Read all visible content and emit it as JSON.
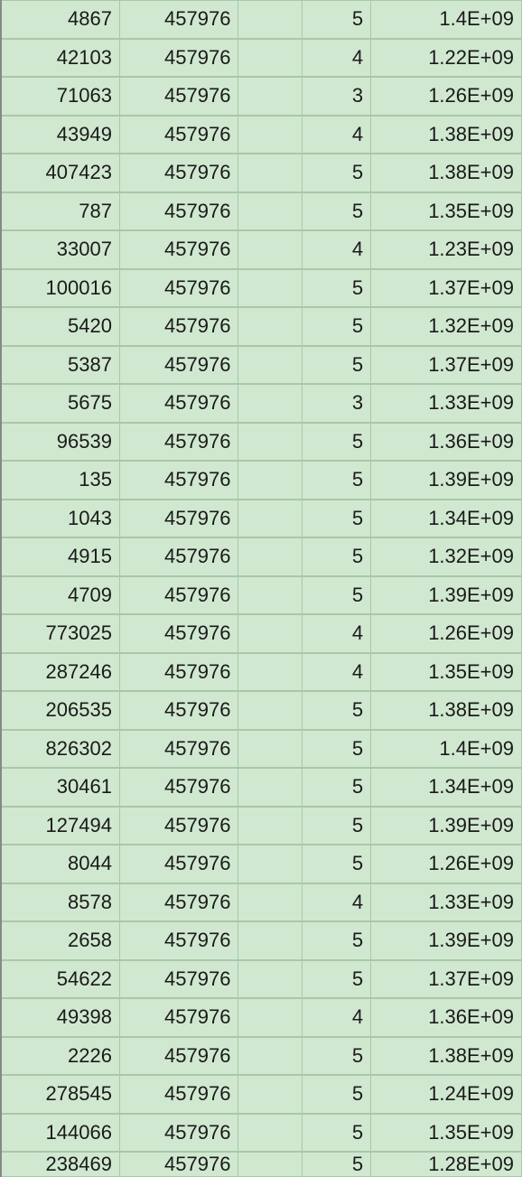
{
  "table": {
    "rows": [
      {
        "a": "4867",
        "b": "457976",
        "c": "",
        "d": "5",
        "e": "1.4E+09"
      },
      {
        "a": "42103",
        "b": "457976",
        "c": "",
        "d": "4",
        "e": "1.22E+09"
      },
      {
        "a": "71063",
        "b": "457976",
        "c": "",
        "d": "3",
        "e": "1.26E+09"
      },
      {
        "a": "43949",
        "b": "457976",
        "c": "",
        "d": "4",
        "e": "1.38E+09"
      },
      {
        "a": "407423",
        "b": "457976",
        "c": "",
        "d": "5",
        "e": "1.38E+09"
      },
      {
        "a": "787",
        "b": "457976",
        "c": "",
        "d": "5",
        "e": "1.35E+09"
      },
      {
        "a": "33007",
        "b": "457976",
        "c": "",
        "d": "4",
        "e": "1.23E+09"
      },
      {
        "a": "100016",
        "b": "457976",
        "c": "",
        "d": "5",
        "e": "1.37E+09"
      },
      {
        "a": "5420",
        "b": "457976",
        "c": "",
        "d": "5",
        "e": "1.32E+09"
      },
      {
        "a": "5387",
        "b": "457976",
        "c": "",
        "d": "5",
        "e": "1.37E+09"
      },
      {
        "a": "5675",
        "b": "457976",
        "c": "",
        "d": "3",
        "e": "1.33E+09"
      },
      {
        "a": "96539",
        "b": "457976",
        "c": "",
        "d": "5",
        "e": "1.36E+09"
      },
      {
        "a": "135",
        "b": "457976",
        "c": "",
        "d": "5",
        "e": "1.39E+09"
      },
      {
        "a": "1043",
        "b": "457976",
        "c": "",
        "d": "5",
        "e": "1.34E+09"
      },
      {
        "a": "4915",
        "b": "457976",
        "c": "",
        "d": "5",
        "e": "1.32E+09"
      },
      {
        "a": "4709",
        "b": "457976",
        "c": "",
        "d": "5",
        "e": "1.39E+09"
      },
      {
        "a": "773025",
        "b": "457976",
        "c": "",
        "d": "4",
        "e": "1.26E+09"
      },
      {
        "a": "287246",
        "b": "457976",
        "c": "",
        "d": "4",
        "e": "1.35E+09"
      },
      {
        "a": "206535",
        "b": "457976",
        "c": "",
        "d": "5",
        "e": "1.38E+09"
      },
      {
        "a": "826302",
        "b": "457976",
        "c": "",
        "d": "5",
        "e": "1.4E+09"
      },
      {
        "a": "30461",
        "b": "457976",
        "c": "",
        "d": "5",
        "e": "1.34E+09"
      },
      {
        "a": "127494",
        "b": "457976",
        "c": "",
        "d": "5",
        "e": "1.39E+09"
      },
      {
        "a": "8044",
        "b": "457976",
        "c": "",
        "d": "5",
        "e": "1.26E+09"
      },
      {
        "a": "8578",
        "b": "457976",
        "c": "",
        "d": "4",
        "e": "1.33E+09"
      },
      {
        "a": "2658",
        "b": "457976",
        "c": "",
        "d": "5",
        "e": "1.39E+09"
      },
      {
        "a": "54622",
        "b": "457976",
        "c": "",
        "d": "5",
        "e": "1.37E+09"
      },
      {
        "a": "49398",
        "b": "457976",
        "c": "",
        "d": "4",
        "e": "1.36E+09"
      },
      {
        "a": "2226",
        "b": "457976",
        "c": "",
        "d": "5",
        "e": "1.38E+09"
      },
      {
        "a": "278545",
        "b": "457976",
        "c": "",
        "d": "5",
        "e": "1.24E+09"
      },
      {
        "a": "144066",
        "b": "457976",
        "c": "",
        "d": "5",
        "e": "1.35E+09"
      },
      {
        "a": "238469",
        "b": "457976",
        "c": "",
        "d": "5",
        "e": "1.28E+09"
      }
    ]
  }
}
